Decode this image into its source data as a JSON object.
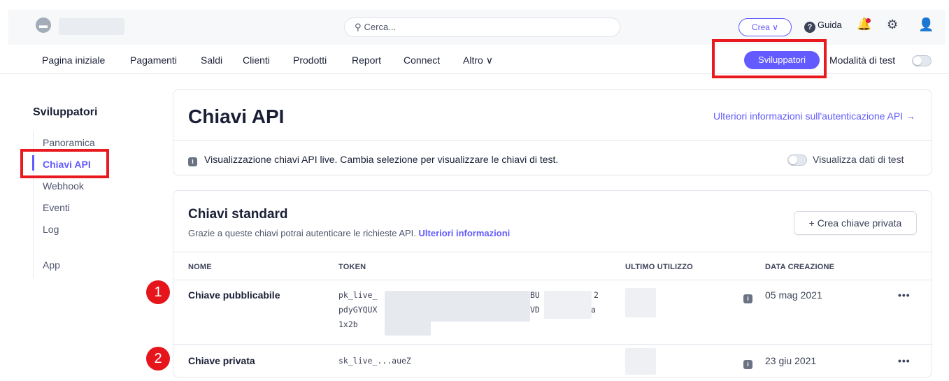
{
  "topbar": {
    "search_placeholder": "Cerca...",
    "create_label": "Crea",
    "help_label": "Guida"
  },
  "nav": {
    "items": [
      "Pagina iniziale",
      "Pagamenti",
      "Saldi",
      "Clienti",
      "Prodotti",
      "Report",
      "Connect",
      "Altro"
    ],
    "developers_label": "Sviluppatori",
    "test_mode_label": "Modalità di test"
  },
  "sidebar": {
    "title": "Sviluppatori",
    "items": [
      {
        "label": "Panoramica",
        "active": false
      },
      {
        "label": "Chiavi API",
        "active": true
      },
      {
        "label": "Webhook",
        "active": false
      },
      {
        "label": "Eventi",
        "active": false
      },
      {
        "label": "Log",
        "active": false
      },
      {
        "label": "App",
        "active": false
      }
    ]
  },
  "header": {
    "title": "Chiavi API",
    "auth_link": "Ulteriori informazioni sull'autenticazione API →",
    "notice": "Visualizzazione chiavi API live. Cambia selezione per visualizzare le chiavi di test.",
    "view_test_label": "Visualizza dati di test"
  },
  "standard_keys": {
    "title": "Chiavi standard",
    "subtitle": "Grazie a queste chiavi potrai autenticare le richieste API.",
    "subtitle_link": "Ulteriori informazioni",
    "create_button": "+ Crea chiave privata",
    "columns": [
      "NOME",
      "TOKEN",
      "ULTIMO UTILIZZO",
      "DATA CREAZIONE"
    ],
    "rows": [
      {
        "badge": "1",
        "name": "Chiave pubblicabile",
        "token_lines": [
          "pk_live_",
          "pdyGYQUX",
          "1x2b"
        ],
        "token_tail": [
          "BU",
          "VD",
          "a"
        ],
        "token_tail_end": "2",
        "created": "05 mag 2021",
        "menu": "•••"
      },
      {
        "badge": "2",
        "name": "Chiave privata",
        "token_lines": [
          "sk_live_...aueZ"
        ],
        "created": "23 giu 2021",
        "menu": "•••"
      }
    ]
  },
  "colors": {
    "accent": "#635bff",
    "highlight": "#e8191f",
    "text": "#1a1f36"
  },
  "icons": [
    "store-icon",
    "search-icon",
    "chevron-down-icon",
    "help-icon",
    "bell-icon",
    "gear-icon",
    "user-icon",
    "info-icon",
    "plus-icon",
    "more-icon"
  ]
}
